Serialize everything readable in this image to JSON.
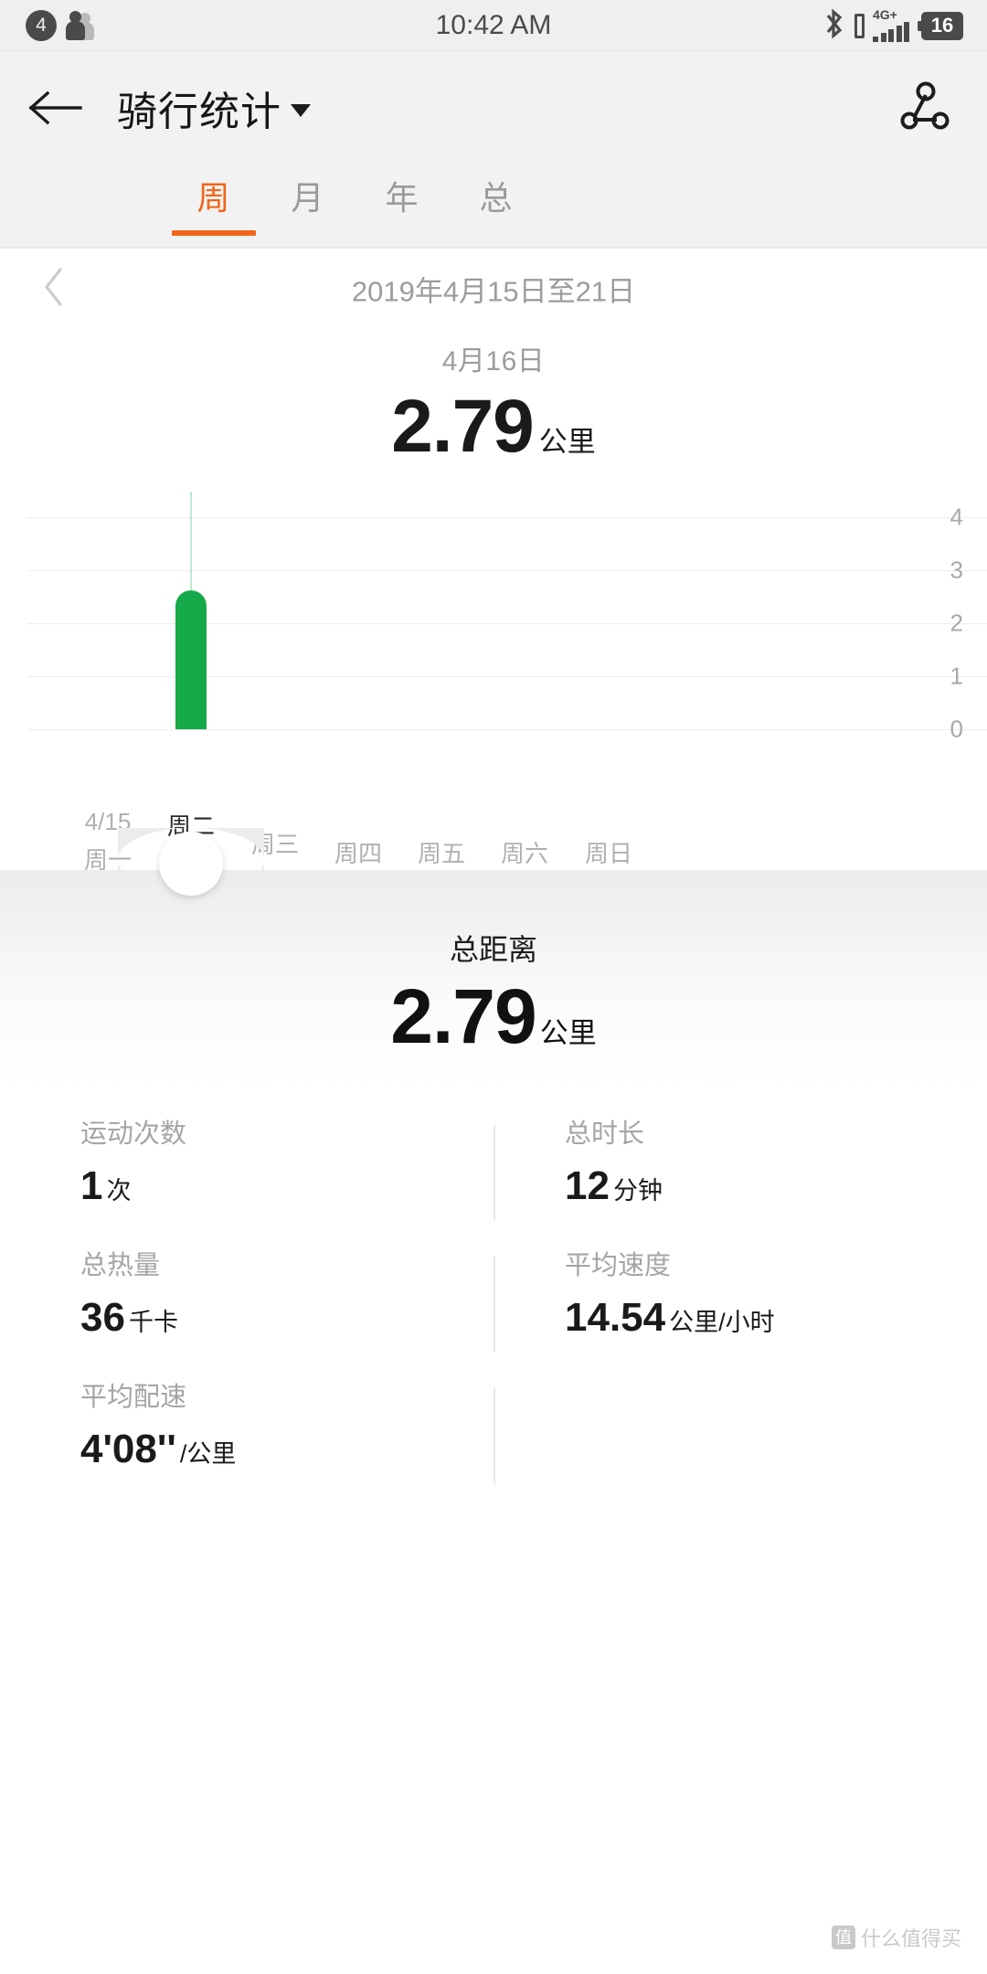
{
  "status_bar": {
    "notification_count": "4",
    "time": "10:42 AM",
    "network_label": "4G+",
    "battery_level": "16"
  },
  "app_bar": {
    "title": "骑行统计",
    "back_icon": "arrow-left-icon",
    "dropdown_icon": "caret-down-icon",
    "share_icon": "share-nodes-icon"
  },
  "tabs": {
    "items": [
      {
        "label": "周",
        "active": true
      },
      {
        "label": "月",
        "active": false
      },
      {
        "label": "年",
        "active": false
      },
      {
        "label": "总",
        "active": false
      }
    ],
    "accent_color": "#f0661a"
  },
  "week_nav": {
    "prev_icon": "chevron-left-icon",
    "range": "2019年4月15日至21日"
  },
  "selected_day": {
    "date": "4月16日",
    "value": "2.79",
    "unit": "公里"
  },
  "chart_data": {
    "type": "bar",
    "title": "",
    "categories": [
      "周一",
      "周二",
      "周三",
      "周四",
      "周五",
      "周六",
      "周日"
    ],
    "category_sublabels": [
      "4/15",
      "",
      "",
      "",
      "",
      "",
      ""
    ],
    "values": [
      0,
      2.79,
      0,
      0,
      0,
      0,
      0
    ],
    "selected_index": 1,
    "ylabel": "",
    "xlabel": "",
    "ylim": [
      0,
      4
    ],
    "yticks": [
      "4",
      "3",
      "2",
      "1",
      "0"
    ],
    "grid": true,
    "bar_color": "#16a94a",
    "unit": "公里"
  },
  "summary": {
    "total_label": "总距离",
    "total_value": "2.79",
    "total_unit": "公里",
    "stats": [
      {
        "label": "运动次数",
        "value": "1",
        "unit": "次"
      },
      {
        "label": "总时长",
        "value": "12",
        "unit": "分钟"
      },
      {
        "label": "总热量",
        "value": "36",
        "unit": "千卡"
      },
      {
        "label": "平均速度",
        "value": "14.54",
        "unit": "公里/小时"
      },
      {
        "label": "平均配速",
        "value": "4'08''",
        "unit": "/公里"
      }
    ]
  },
  "watermark": {
    "badge": "值",
    "text": "什么值得买"
  }
}
